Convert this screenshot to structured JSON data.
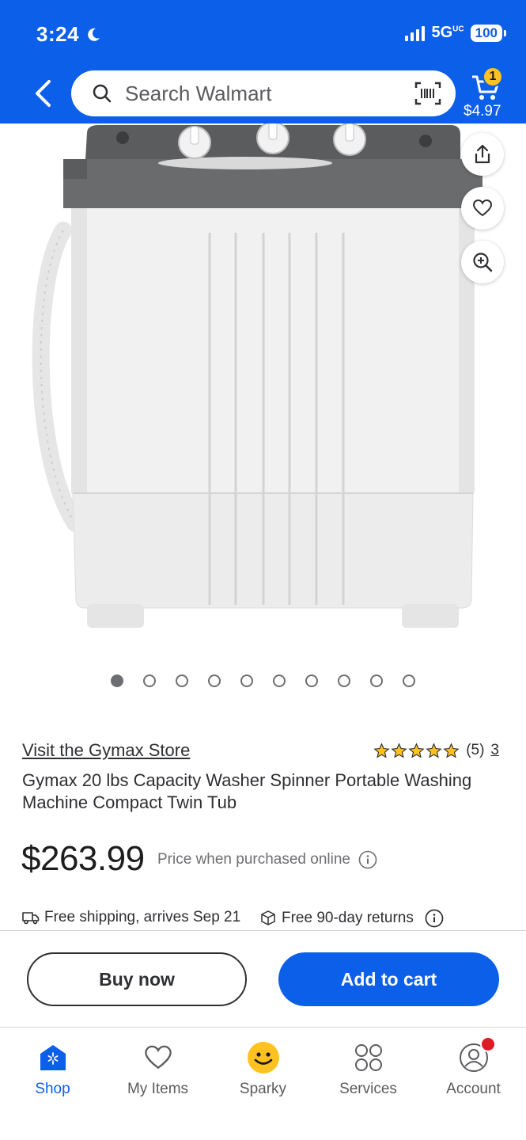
{
  "status_bar": {
    "time": "3:24",
    "network": "5G",
    "network_sup": "UC",
    "battery": "100"
  },
  "header": {
    "search_placeholder": "Search Walmart",
    "cart_count": "1",
    "cart_total": "$4.97"
  },
  "gallery": {
    "image_count": 10,
    "active_index": 0
  },
  "product": {
    "store_link": "Visit the Gymax Store",
    "rating": 5,
    "review_count": "(5)",
    "rating_link": "3",
    "title": "Gymax 20 lbs Capacity Washer Spinner Portable Washing Machine Compact Twin Tub",
    "price": "$263.99",
    "price_note": "Price when purchased online"
  },
  "fulfillment": {
    "shipping": "Free shipping, arrives Sep 21",
    "returns": "Free 90-day returns"
  },
  "actions": {
    "buy_now": "Buy now",
    "add_to_cart": "Add to cart"
  },
  "bottom_nav": {
    "items": [
      {
        "label": "Shop",
        "icon": "shop-icon"
      },
      {
        "label": "My Items",
        "icon": "heart-icon"
      },
      {
        "label": "Sparky",
        "icon": "sparky-icon"
      },
      {
        "label": "Services",
        "icon": "services-icon"
      },
      {
        "label": "Account",
        "icon": "account-icon"
      }
    ]
  },
  "colors": {
    "brand_blue": "#0b5fe8",
    "star_yellow": "#ffc220",
    "notification_red": "#de1c24"
  }
}
